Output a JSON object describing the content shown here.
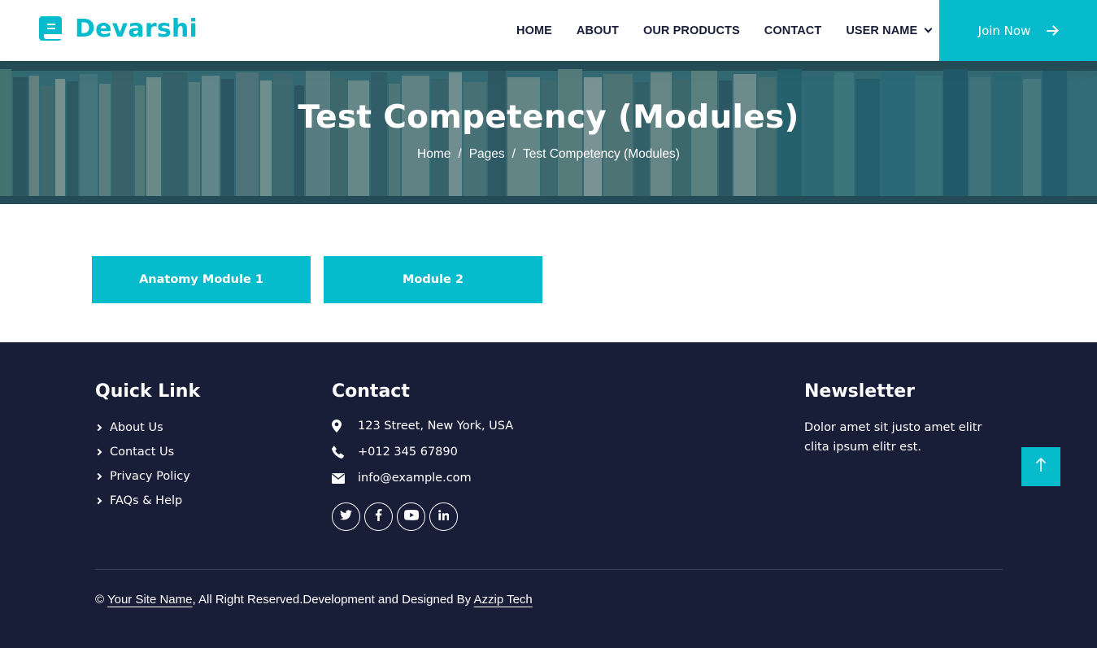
{
  "navbar": {
    "brand": "Devarshi",
    "menu": [
      "HOME",
      "ABOUT",
      "OUR PRODUCTS",
      "CONTACT",
      "USER NAME"
    ],
    "join_label": "Join Now"
  },
  "hero": {
    "title": "Test Competency (Modules)",
    "breadcrumb": [
      "Home",
      "Pages",
      "Test Competency (Modules)"
    ],
    "separator": "/"
  },
  "modules": [
    "Anatomy Module 1",
    "Module 2"
  ],
  "footer": {
    "quick_link": {
      "heading": "Quick Link",
      "items": [
        "About Us",
        "Contact Us",
        "Privacy Policy",
        "FAQs & Help"
      ]
    },
    "contact": {
      "heading": "Contact",
      "address": "123 Street, New York, USA",
      "phone": "+012 345 67890",
      "email": "info@example.com",
      "social": [
        "twitter-icon",
        "facebook-icon",
        "youtube-icon",
        "linkedin-icon"
      ]
    },
    "newsletter": {
      "heading": "Newsletter",
      "text": "Dolor amet sit justo amet elitr clita ipsum elitr est."
    },
    "copyright": {
      "symbol": "©",
      "site_name": "Your Site Name",
      "middle": ", All Right Reserved.Development and Designed By ",
      "designer": "Azzip Tech"
    }
  },
  "colors": {
    "accent": "#06bbcc",
    "dark": "#181d38",
    "white": "#ffffff"
  }
}
